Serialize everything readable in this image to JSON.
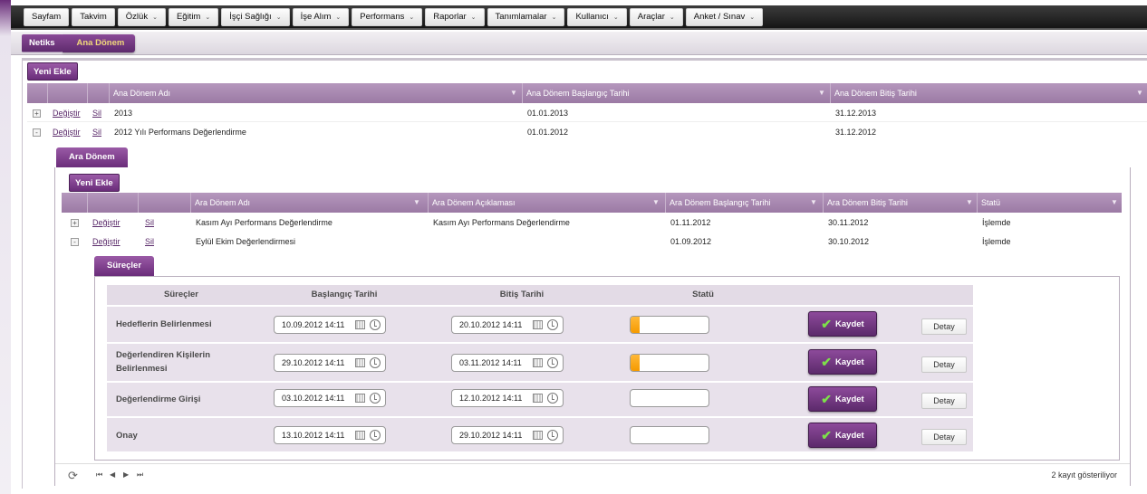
{
  "nav": {
    "items": [
      {
        "label": "Sayfam",
        "dropdown": false
      },
      {
        "label": "Takvim",
        "dropdown": false
      },
      {
        "label": "Özlük",
        "dropdown": true
      },
      {
        "label": "Eğitim",
        "dropdown": true
      },
      {
        "label": "İşçi Sağlığı",
        "dropdown": true
      },
      {
        "label": "İşe Alım",
        "dropdown": true
      },
      {
        "label": "Performans",
        "dropdown": true
      },
      {
        "label": "Raporlar",
        "dropdown": true
      },
      {
        "label": "Tanımlamalar",
        "dropdown": true
      },
      {
        "label": "Kullanıcı",
        "dropdown": true
      },
      {
        "label": "Araçlar",
        "dropdown": true
      },
      {
        "label": "Anket / Sınav",
        "dropdown": true
      }
    ]
  },
  "breadcrumb": {
    "root": "Netiks",
    "current": "Ana Dönem"
  },
  "main": {
    "add_label": "Yeni Ekle",
    "columns": [
      "Ana Dönem Adı",
      "Ana Dönem Başlangıç Tarihi",
      "Ana Dönem Bitiş Tarihi"
    ],
    "rows": [
      {
        "expander": "+",
        "edit": "Değiştir",
        "delete": "Sil",
        "name": "2013",
        "start": "01.01.2013",
        "end": "31.12.2013"
      },
      {
        "expander": "-",
        "edit": "Değiştir",
        "delete": "Sil",
        "name": "2012 Yılı Performans Değerlendirme",
        "start": "01.01.2012",
        "end": "31.12.2012"
      }
    ]
  },
  "sub": {
    "tab_label": "Ara Dönem",
    "add_label": "Yeni Ekle",
    "columns": [
      "Ara Dönem Adı",
      "Ara Dönem Açıklaması",
      "Ara Dönem Başlangıç Tarihi",
      "Ara Dönem Bitiş Tarihi",
      "Statü"
    ],
    "rows": [
      {
        "expander": "+",
        "edit": "Değiştir",
        "delete": "Sil",
        "name": "Kasım Ayı Performans Değerlendirme",
        "desc": "Kasım Ayı Performans Değerlendirme",
        "start": "01.11.2012",
        "end": "30.11.2012",
        "status": "İşlemde"
      },
      {
        "expander": "-",
        "edit": "Değiştir",
        "delete": "Sil",
        "name": "Eylül Ekim Değerlendirmesi",
        "desc": "",
        "start": "01.09.2012",
        "end": "30.10.2012",
        "status": "İşlemde"
      }
    ]
  },
  "processes": {
    "tab_label": "Süreçler",
    "columns": [
      "Süreçler",
      "Başlangıç Tarihi",
      "Bitiş Tarihi",
      "Statü"
    ],
    "save_label": "Kaydet",
    "detail_label": "Detay",
    "rows": [
      {
        "name_line1": "Hedeflerin Belirlenmesi",
        "name_line2": "",
        "start": "10.09.2012 14:11",
        "end": "20.10.2012 14:11",
        "progress": 0.12
      },
      {
        "name_line1": "Değerlendiren Kişilerin",
        "name_line2": "Belirlenmesi",
        "start": "29.10.2012 14:11",
        "end": "03.11.2012 14:11",
        "progress": 0.12
      },
      {
        "name_line1": "Değerlendirme Girişi",
        "name_line2": "",
        "start": "03.10.2012 14:11",
        "end": "12.10.2012 14:11",
        "progress": 0
      },
      {
        "name_line1": "Onay",
        "name_line2": "",
        "start": "13.10.2012 14:11",
        "end": "29.10.2012 14:11",
        "progress": 0
      }
    ]
  },
  "pager": {
    "count_label": "2 kayıt gösteriliyor"
  },
  "colors": {
    "accent": "#6a2d7a",
    "header": "#a98bb1",
    "progress": "#f5a000"
  }
}
